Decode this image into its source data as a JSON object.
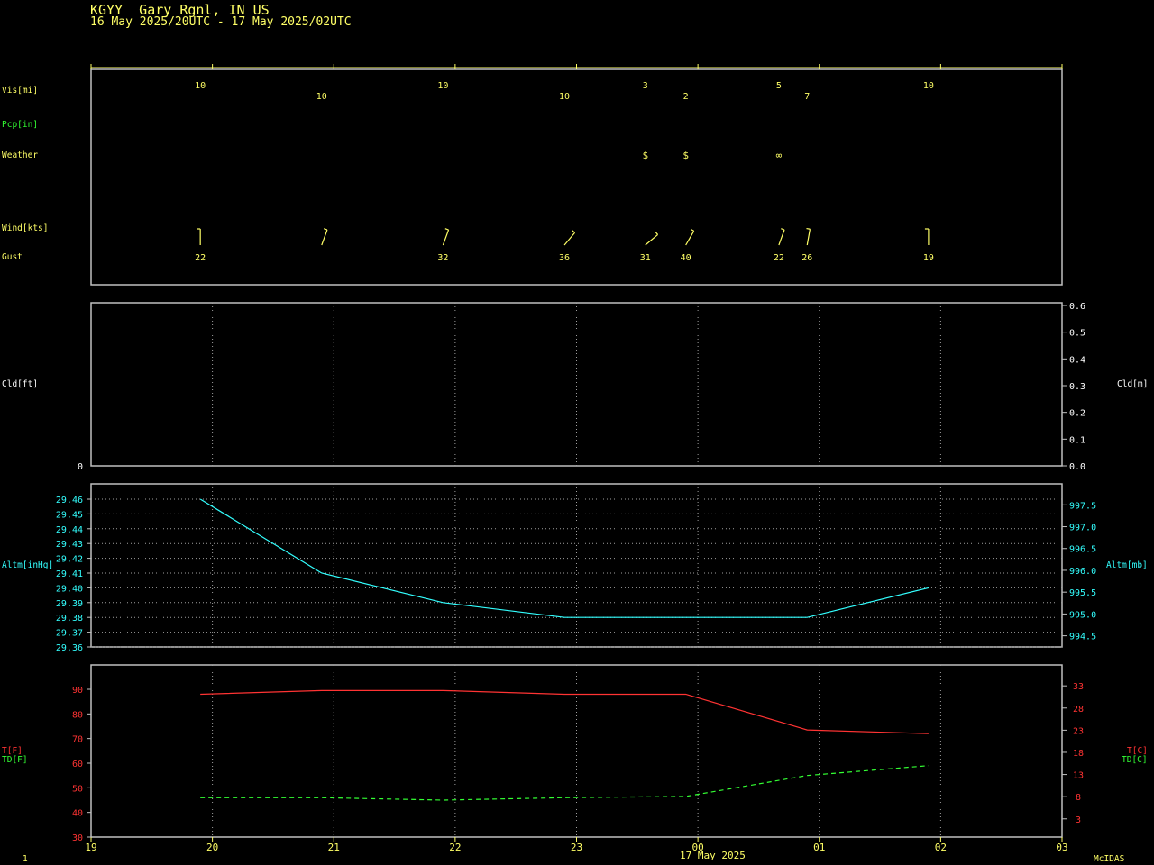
{
  "header": {
    "station": "KGYY  Gary Rgnl, IN US",
    "period": "16 May 2025/20UTC - 17 May 2025/02UTC"
  },
  "colors": {
    "frame": "#c0c0c0",
    "grid": "#a0a0a0",
    "yellow": "#ffff66",
    "green": "#33ff33",
    "cyan": "#33ffff",
    "red": "#ff3333",
    "white": "#ffffff"
  },
  "time_axis": {
    "ticks": [
      "19",
      "20",
      "21",
      "22",
      "23",
      "00",
      "01",
      "02",
      "03"
    ],
    "date_label": "17 May 2025"
  },
  "footer": {
    "left": "1",
    "right": "McIDAS"
  },
  "labels": {
    "vis": "Vis[mi]",
    "pcp": "Pcp[in]",
    "weather": "Weather",
    "wind": "Wind[kts]",
    "gust": "Gust",
    "cld_ft": "Cld[ft]",
    "cld_m": "Cld[m]",
    "altm_inhg": "Altm[inHg]",
    "altm_mb": "Altm[mb]",
    "t_f": "T[F]",
    "td_f": "TD[F]",
    "t_c": "T[C]",
    "td_c": "TD[C]"
  },
  "chart_data": [
    {
      "type": "table",
      "panel": "observations",
      "observations": [
        {
          "time": "19:54",
          "vis": "10",
          "weather": "",
          "wind_dir": 180,
          "gust": "22"
        },
        {
          "time": "20:54",
          "vis": "10",
          "weather": "",
          "wind_dir": 200,
          "gust": ""
        },
        {
          "time": "21:54",
          "vis": "10",
          "weather": "",
          "wind_dir": 200,
          "gust": "32"
        },
        {
          "time": "22:54",
          "vis": "10",
          "weather": "",
          "wind_dir": 220,
          "gust": "36"
        },
        {
          "time": "23:34",
          "vis": "3",
          "weather": "$",
          "wind_dir": 230,
          "gust": "31"
        },
        {
          "time": "23:54",
          "vis": "2",
          "weather": "$",
          "wind_dir": 210,
          "gust": "40"
        },
        {
          "time": "00:40",
          "vis": "5",
          "weather": "∞",
          "wind_dir": 200,
          "gust": "22"
        },
        {
          "time": "00:54",
          "vis": "7",
          "weather": "",
          "wind_dir": 190,
          "gust": "26"
        },
        {
          "time": "01:54",
          "vis": "10",
          "weather": "",
          "wind_dir": 180,
          "gust": "19"
        }
      ]
    },
    {
      "type": "line",
      "panel": "cloud",
      "ylabel": "Cld[ft]",
      "ylabel_right": "Cld[m]",
      "left_ticks": [
        "0"
      ],
      "right_ticks": [
        "0.6",
        "0.5",
        "0.4",
        "0.3",
        "0.2",
        "0.1",
        "0.0"
      ],
      "series": []
    },
    {
      "type": "line",
      "panel": "altimeter",
      "ylabel": "Altm[inHg]",
      "ylabel_right": "Altm[mb]",
      "ylim": [
        29.36,
        29.46
      ],
      "left_ticks": [
        "29.46",
        "29.45",
        "29.44",
        "29.43",
        "29.42",
        "29.41",
        "29.40",
        "29.39",
        "29.38",
        "29.37",
        "29.36"
      ],
      "right_ticks": [
        "997.5",
        "997.0",
        "996.5",
        "996.0",
        "995.5",
        "995.0",
        "994.5"
      ],
      "x": [
        "19:54",
        "20:54",
        "21:54",
        "22:54",
        "23:54",
        "00:54",
        "01:54"
      ],
      "series": [
        {
          "values": [
            29.46,
            29.41,
            29.39,
            29.38,
            29.38,
            29.38,
            29.4
          ]
        }
      ],
      "grid": true
    },
    {
      "type": "line",
      "panel": "temperature",
      "ylabel": "T[F]",
      "ylabel2": "TD[F]",
      "ylabel_right": "T[C]",
      "ylabel_right2": "TD[C]",
      "ylim": [
        30,
        95
      ],
      "left_ticks": [
        "90",
        "80",
        "70",
        "60",
        "50",
        "40",
        "30"
      ],
      "right_ticks": [
        "33",
        "28",
        "23",
        "18",
        "13",
        "8",
        "3"
      ],
      "x": [
        "19:54",
        "20:54",
        "21:54",
        "22:54",
        "23:54",
        "00:54",
        "01:54"
      ],
      "series": [
        {
          "values": [
            88,
            89.5,
            89.5,
            88,
            88,
            73.5,
            72
          ]
        },
        {
          "values": [
            46,
            46,
            45,
            46,
            46.5,
            55,
            59
          ]
        }
      ]
    }
  ]
}
